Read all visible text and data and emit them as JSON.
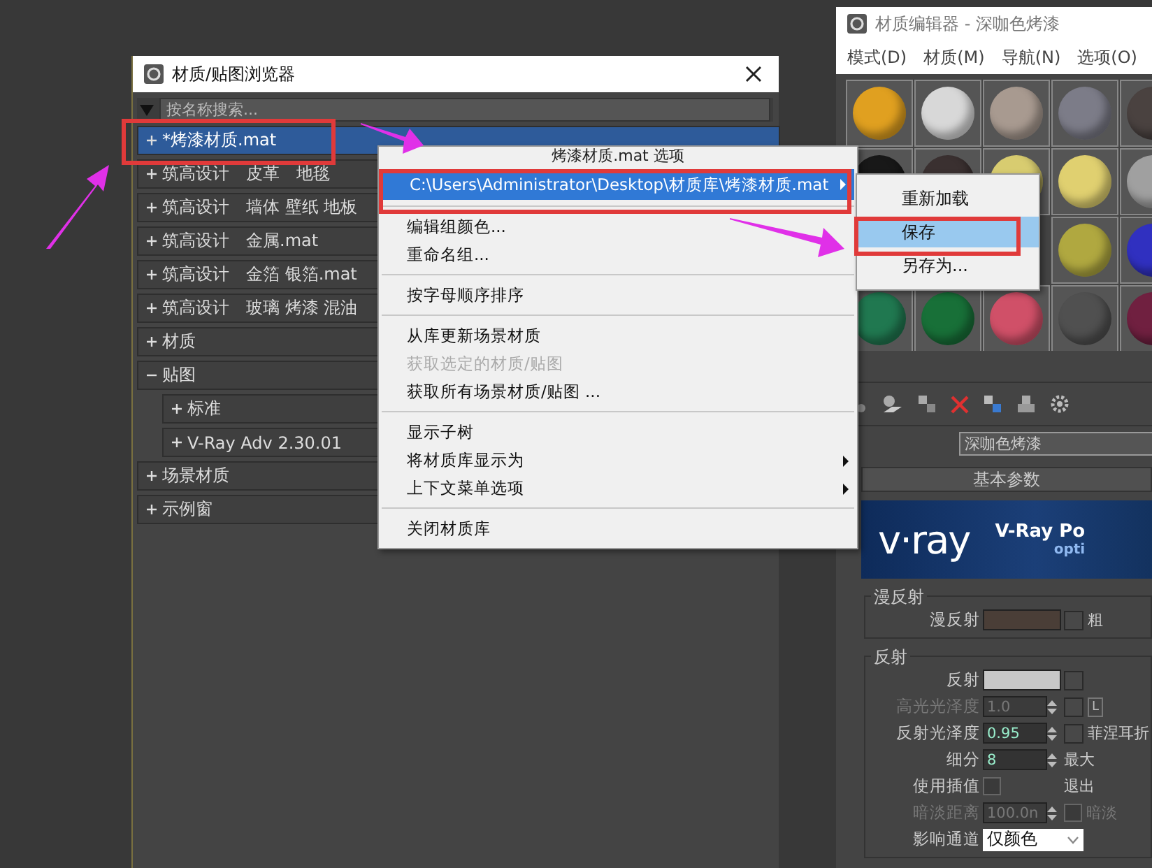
{
  "browser": {
    "title": "材质/贴图浏览器",
    "search": {
      "placeholder": "按名称搜索..."
    },
    "groups": [
      {
        "label": "*烤漆材质.mat",
        "expanded": false,
        "selected": true
      },
      {
        "label": "筑高设计　皮革　地毯",
        "expanded": false,
        "selected": false
      },
      {
        "label": "筑高设计　墙体 壁纸 地板",
        "expanded": false,
        "selected": false
      },
      {
        "label": "筑高设计　金属.mat",
        "expanded": false,
        "selected": false
      },
      {
        "label": "筑高设计　金箔 银箔.mat",
        "expanded": false,
        "selected": false
      },
      {
        "label": "筑高设计　玻璃 烤漆 混油",
        "expanded": false,
        "selected": false
      },
      {
        "label": "材质",
        "expanded": false,
        "selected": false
      },
      {
        "label": "贴图",
        "expanded": true,
        "selected": false,
        "children": [
          {
            "label": "标准",
            "expanded": false,
            "selected": false
          },
          {
            "label": "V-Ray Adv 2.30.01",
            "expanded": false,
            "selected": false
          }
        ]
      },
      {
        "label": "场景材质",
        "expanded": false,
        "selected": false
      },
      {
        "label": "示例窗",
        "expanded": false,
        "selected": false
      }
    ]
  },
  "context_menu": {
    "title": "烤漆材质.mat 选项",
    "items": [
      {
        "kind": "item",
        "label": "C:\\Users\\Administrator\\Desktop\\材质库\\烤漆材质.mat",
        "selected": true,
        "disabled": false,
        "submenu": true
      },
      {
        "kind": "separator"
      },
      {
        "kind": "item",
        "label": "编辑组颜色...",
        "selected": false,
        "disabled": false,
        "submenu": false
      },
      {
        "kind": "item",
        "label": "重命名组...",
        "selected": false,
        "disabled": false,
        "submenu": false
      },
      {
        "kind": "separator"
      },
      {
        "kind": "item",
        "label": "按字母顺序排序",
        "selected": false,
        "disabled": false,
        "submenu": false
      },
      {
        "kind": "separator"
      },
      {
        "kind": "item",
        "label": "从库更新场景材质",
        "selected": false,
        "disabled": false,
        "submenu": false
      },
      {
        "kind": "item",
        "label": "获取选定的材质/贴图",
        "selected": false,
        "disabled": true,
        "submenu": false
      },
      {
        "kind": "item",
        "label": "获取所有场景材质/贴图 ...",
        "selected": false,
        "disabled": false,
        "submenu": false
      },
      {
        "kind": "separator"
      },
      {
        "kind": "item",
        "label": "显示子树",
        "selected": false,
        "disabled": false,
        "submenu": false
      },
      {
        "kind": "item",
        "label": "将材质库显示为",
        "selected": false,
        "disabled": false,
        "submenu": true
      },
      {
        "kind": "item",
        "label": "上下文菜单选项",
        "selected": false,
        "disabled": false,
        "submenu": true
      },
      {
        "kind": "separator"
      },
      {
        "kind": "item",
        "label": "关闭材质库",
        "selected": false,
        "disabled": false,
        "submenu": false
      }
    ]
  },
  "submenu": {
    "items": [
      {
        "label": "重新加载",
        "selected": false
      },
      {
        "label": "保存",
        "selected": true
      },
      {
        "label": "另存为...",
        "selected": false
      }
    ]
  },
  "editor": {
    "title": "材质编辑器 - 深咖色烤漆",
    "menu": [
      "模式(D)",
      "材质(M)",
      "导航(N)",
      "选项(O)"
    ],
    "spheres": [
      {
        "color": "#e0a020"
      },
      {
        "color": "#d8d8d8"
      },
      {
        "color": "#a89a90"
      },
      {
        "color": "#7c7c88"
      },
      {
        "color": "#4a4240"
      },
      {
        "color": "#181818"
      },
      {
        "color": "#3a3030"
      },
      {
        "color": "#d8cc70"
      },
      {
        "color": "#e0d070"
      },
      {
        "color": "#a0a0a0"
      },
      {
        "color": "#b0a840"
      },
      {
        "color": "#3030c0"
      },
      {
        "color": "#207850"
      },
      {
        "color": "#187038"
      },
      {
        "color": "#d05068"
      },
      {
        "color": "#505050"
      },
      {
        "color": "#702040"
      }
    ],
    "material_name": "深咖色烤漆",
    "rollout": "基本参数",
    "logo": "v·ray",
    "banner_title": "V-Ray Po",
    "banner_subtitle": "opti",
    "groups": [
      {
        "title": "漫反射",
        "rows": [
          {
            "kind": "color",
            "label": "漫反射",
            "color": "#4a3e37",
            "has_box": true,
            "side_label": "粗"
          }
        ]
      },
      {
        "title": "反射",
        "rows": [
          {
            "kind": "color",
            "label": "反射",
            "color": "#c8c8c8",
            "has_box": true
          },
          {
            "kind": "spinner",
            "label": "高光光泽度",
            "value": "1.0",
            "disabled": true,
            "has_box": true,
            "button": "L"
          },
          {
            "kind": "spinner",
            "label": "反射光泽度",
            "value": "0.95",
            "disabled": false,
            "has_box": true,
            "side_label": "菲涅耳折"
          },
          {
            "kind": "spinner",
            "label": "细分",
            "value": "8",
            "disabled": false,
            "side_label": "最大"
          },
          {
            "kind": "checkbox",
            "label": "使用插值",
            "checked": false,
            "side_label": "退出"
          },
          {
            "kind": "spinner",
            "label": "暗淡距离",
            "value": "100.0n",
            "disabled": true,
            "checked": false,
            "side_label": "暗淡"
          },
          {
            "kind": "dropdown",
            "label": "影响通道",
            "value": "仅颜色"
          }
        ]
      }
    ]
  }
}
